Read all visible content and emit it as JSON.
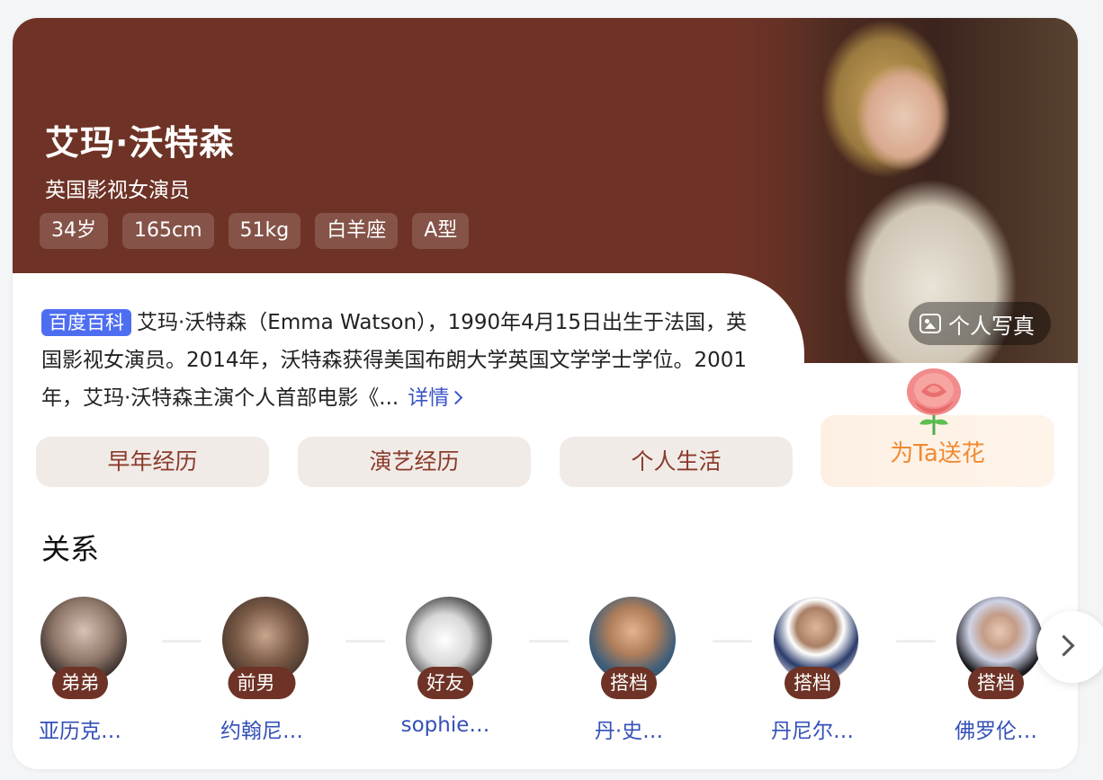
{
  "profile": {
    "name": "艾玛·沃特森",
    "subtitle": "英国影视女演员",
    "tags": [
      "34岁",
      "165cm",
      "51kg",
      "白羊座",
      "A型"
    ],
    "photo_button": "个人写真"
  },
  "summary": {
    "source": "百度百科",
    "text": "艾玛·沃特森（Emma Watson），1990年4月15日出生于法国，英国影视女演员。2014年，沃特森获得美国布朗大学英国文学学士学位。2001年，艾玛·沃特森主演个人首部电影《...",
    "more_label": "详情"
  },
  "pills": [
    "早年经历",
    "演艺经历",
    "个人生活"
  ],
  "flower_button": "为Ta送花",
  "relations": {
    "title": "关系",
    "items": [
      {
        "relation": "弟弟",
        "name": "亚历克…"
      },
      {
        "relation": "前男友",
        "name": "约翰尼…"
      },
      {
        "relation": "好友",
        "name": "sophie…"
      },
      {
        "relation": "搭档",
        "name": "丹·史…"
      },
      {
        "relation": "搭档",
        "name": "丹尼尔…"
      },
      {
        "relation": "搭档",
        "name": "佛罗伦…"
      }
    ]
  },
  "colors": {
    "hero_background": "#6e3326",
    "accent_link": "#3a55c5",
    "source_badge": "#4e6ef2",
    "flower_text": "#f08a32"
  }
}
